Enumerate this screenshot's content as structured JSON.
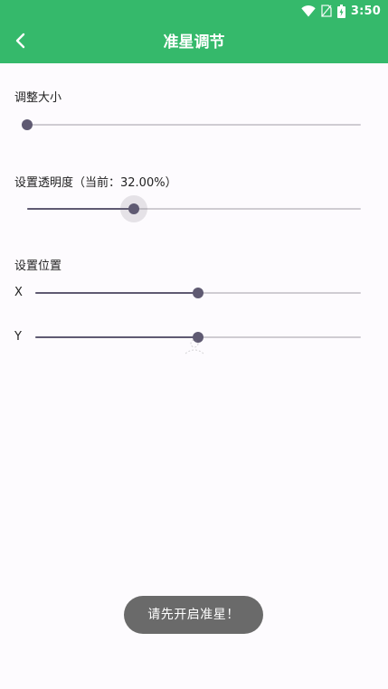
{
  "status_bar": {
    "time": "3:50",
    "icons": [
      "wifi-icon",
      "no-sim-icon",
      "battery-charging-icon"
    ],
    "background": "#35b96b"
  },
  "app_bar": {
    "title": "准星调节",
    "back_icon": "chevron-left-icon",
    "background": "#35b96b"
  },
  "settings": {
    "size": {
      "label": "调整大小",
      "value": 0.0
    },
    "opacity": {
      "label": "设置透明度（当前：32.00%）",
      "value": 0.32
    },
    "position": {
      "label": "设置位置",
      "x": {
        "label": "X",
        "value": 0.5
      },
      "y": {
        "label": "Y",
        "value": 0.5
      }
    }
  },
  "toast": {
    "text": "请先开启准星！"
  },
  "colors": {
    "accent": "#35b96b",
    "slider_active": "#5f5a72",
    "slider_inactive": "#cfccd2",
    "toast_bg": "#6a6a6a"
  }
}
